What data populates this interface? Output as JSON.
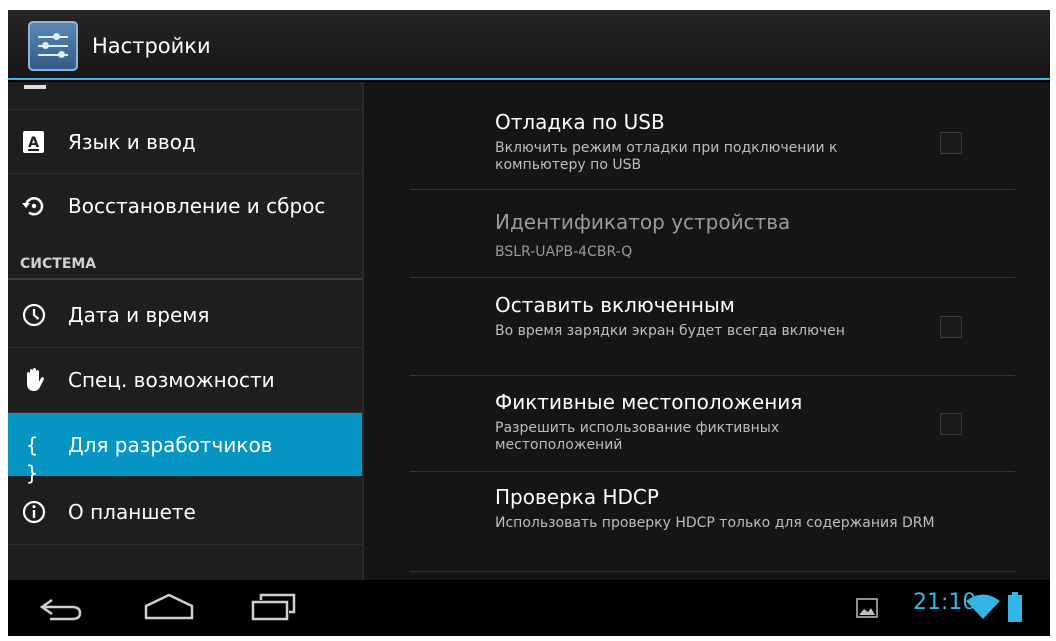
{
  "app": {
    "title": "Настройки"
  },
  "sidebar": {
    "items": [
      {
        "id": "language",
        "label": "Язык и ввод",
        "icon": "keyboard-a-icon"
      },
      {
        "id": "backup",
        "label": "Восстановление и сброс",
        "icon": "restore-icon"
      }
    ],
    "section_header": "СИСТЕМА",
    "system_items": [
      {
        "id": "date",
        "label": "Дата и время",
        "icon": "clock-icon"
      },
      {
        "id": "accessibility",
        "label": "Спец. возможности",
        "icon": "hand-icon"
      },
      {
        "id": "developer",
        "label": "Для разработчиков",
        "icon": "braces-icon",
        "glyph": "{ }",
        "selected": true
      },
      {
        "id": "about",
        "label": "О планшете",
        "icon": "info-icon"
      }
    ]
  },
  "preferences": [
    {
      "title": "Отладка по USB",
      "summary": "Включить режим отладки при подключении к компьютеру по USB",
      "checkbox": true,
      "checked": false,
      "enabled": true
    },
    {
      "title": "Идентификатор устройства",
      "summary": "BSLR-UAPB-4CBR-Q",
      "checkbox": false,
      "enabled": false
    },
    {
      "title": "Оставить включенным",
      "summary": "Во время зарядки экран будет всегда включен",
      "checkbox": true,
      "checked": false,
      "enabled": true
    },
    {
      "title": "Фиктивные местоположения",
      "summary": "Разрешить использование фиктивных местоположений",
      "checkbox": true,
      "checked": false,
      "enabled": true
    },
    {
      "title": "Проверка HDCP",
      "summary": "Использовать проверку HDCP только для содержания DRM",
      "checkbox": false,
      "enabled": true
    }
  ],
  "status_bar": {
    "time": "21:10",
    "icons": [
      "gallery-thumbnail-icon",
      "wifi-icon",
      "battery-icon"
    ]
  },
  "nav_buttons": [
    "back-icon",
    "home-icon",
    "recents-icon"
  ],
  "colors": {
    "accent": "#33b5e5",
    "selected": "#0795c4"
  }
}
